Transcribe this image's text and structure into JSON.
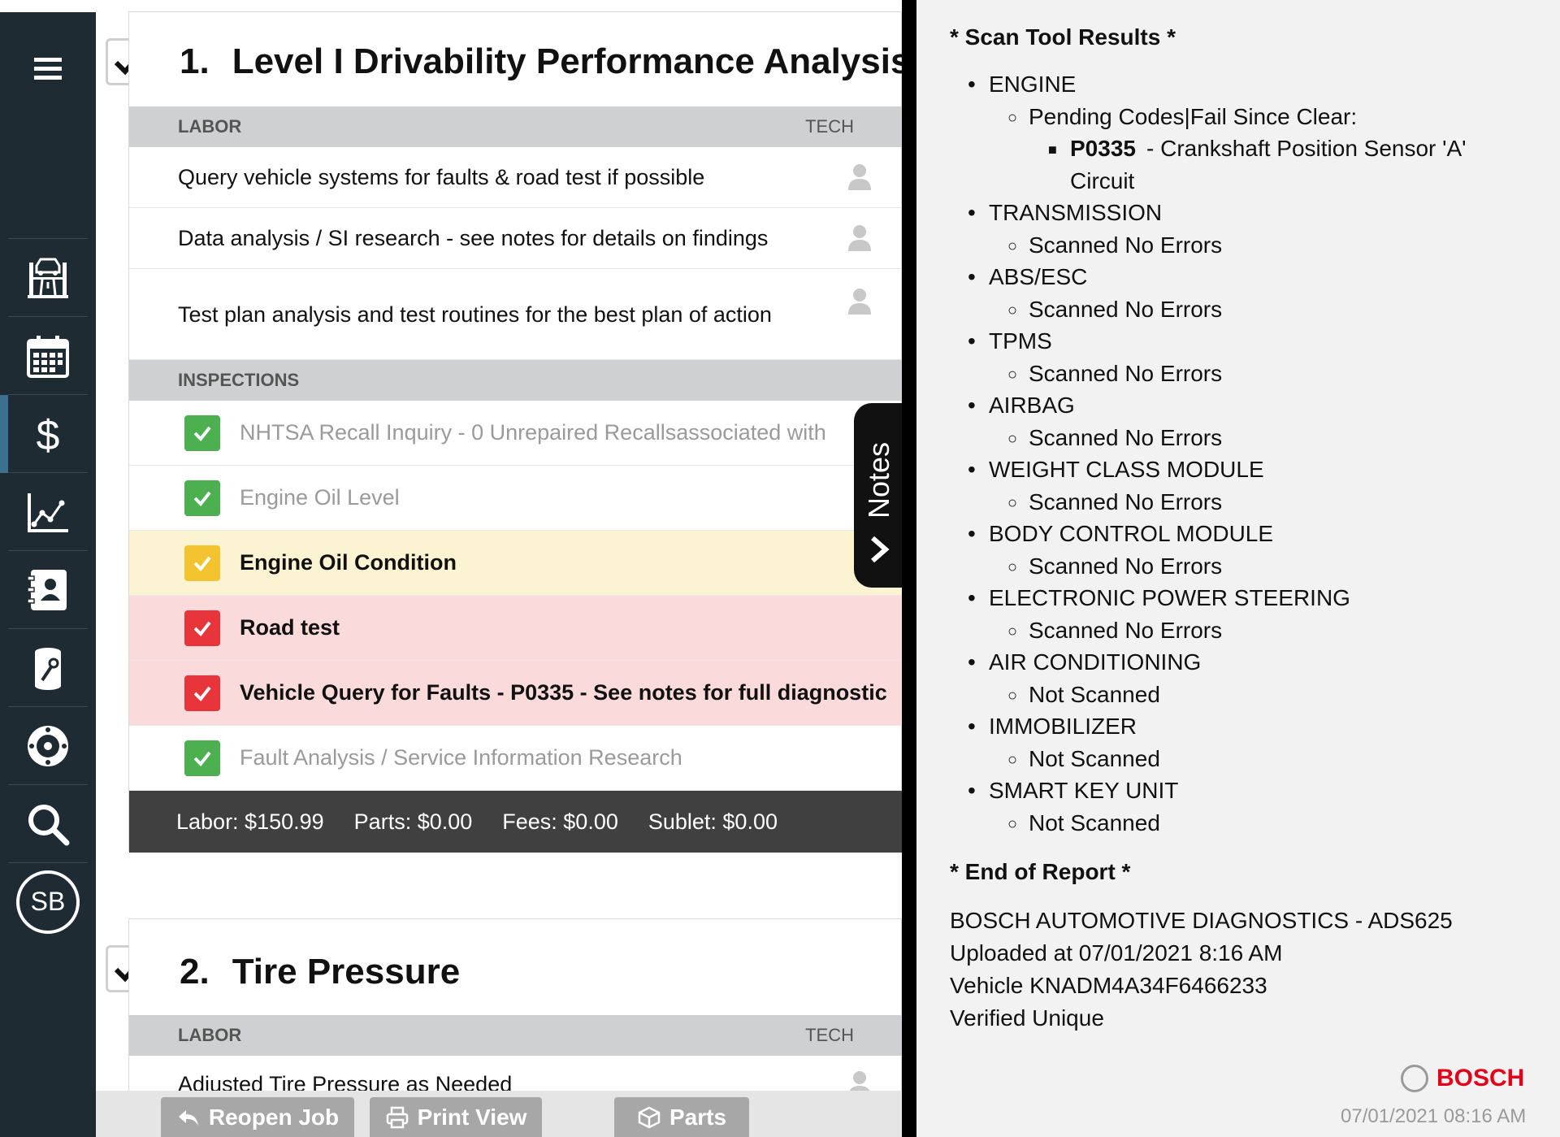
{
  "sidebar": {
    "items": [
      {
        "name": "menu-icon"
      },
      {
        "name": "vehicle-lift-icon"
      },
      {
        "name": "calendar-icon"
      },
      {
        "name": "dollar-icon"
      },
      {
        "name": "chart-icon"
      },
      {
        "name": "contacts-icon"
      },
      {
        "name": "parts-tool-icon"
      },
      {
        "name": "tire-icon"
      },
      {
        "name": "search-icon"
      }
    ],
    "avatar": "SB"
  },
  "job1": {
    "number": "1.",
    "title": "Level I Drivability Performance Analysis",
    "labor_header": "LABOR",
    "tech_header": "TECH",
    "labor": [
      "Query vehicle systems for faults & road test if possible",
      "Data analysis / SI research - see notes for details on findings",
      "Test plan analysis and test routines for the best plan of action"
    ],
    "inspections_header": "INSPECTIONS",
    "inspections": [
      {
        "text": "NHTSA Recall Inquiry - 0 Unrepaired Recallsassociated with",
        "status": "green"
      },
      {
        "text": "Engine Oil Level",
        "status": "green"
      },
      {
        "text": "Engine Oil Condition",
        "status": "yellow"
      },
      {
        "text": "Road test",
        "status": "red"
      },
      {
        "text": "Vehicle Query for Faults - P0335 - See notes for full diagnostic",
        "status": "red"
      },
      {
        "text": "Fault Analysis / Service Information Research",
        "status": "green"
      }
    ],
    "totals": {
      "labor": "Labor: $150.99",
      "parts": "Parts: $0.00",
      "fees": "Fees: $0.00",
      "sublet": "Sublet: $0.00"
    }
  },
  "job2": {
    "number": "2.",
    "title": "Tire Pressure",
    "labor_header": "LABOR",
    "tech_header": "TECH",
    "labor": [
      "Adjusted Tire Pressure as Needed"
    ]
  },
  "notes_tab": "Notes",
  "buttons": {
    "reopen": "Reopen Job",
    "print": "Print View",
    "parts": "Parts"
  },
  "report": {
    "header": "* Scan Tool Results *",
    "systems": [
      {
        "name": "ENGINE",
        "status": "Pending Codes|Fail Since Clear:",
        "code": "P0335",
        "code_desc": "- Crankshaft Position Sensor 'A'",
        "code_desc2": "Circuit"
      },
      {
        "name": "TRANSMISSION",
        "status": "Scanned No Errors"
      },
      {
        "name": "ABS/ESC",
        "status": "Scanned No Errors"
      },
      {
        "name": "TPMS",
        "status": "Scanned No Errors"
      },
      {
        "name": "AIRBAG",
        "status": "Scanned No Errors"
      },
      {
        "name": "WEIGHT CLASS MODULE",
        "status": "Scanned No Errors"
      },
      {
        "name": "BODY CONTROL MODULE",
        "status": "Scanned No Errors"
      },
      {
        "name": "ELECTRONIC POWER STEERING",
        "status": "Scanned No Errors"
      },
      {
        "name": "AIR CONDITIONING",
        "status": "Not Scanned"
      },
      {
        "name": "IMMOBILIZER",
        "status": "Not Scanned"
      },
      {
        "name": "SMART KEY UNIT",
        "status": "Not Scanned"
      }
    ],
    "end": "* End of Report *",
    "info": [
      "BOSCH AUTOMOTIVE DIAGNOSTICS - ADS625",
      "Uploaded at 07/01/2021 8:16 AM",
      "Vehicle KNADM4A34F6466233",
      "Verified Unique"
    ],
    "brand": "BOSCH",
    "timestamp": "07/01/2021 08:16 AM"
  },
  "colors": {
    "sidebar": "#1e2b33",
    "green": "#4cb050",
    "yellow": "#f4c430",
    "red": "#e8353b",
    "row_yellow": "#fcf3d2",
    "row_red": "#fadada"
  }
}
